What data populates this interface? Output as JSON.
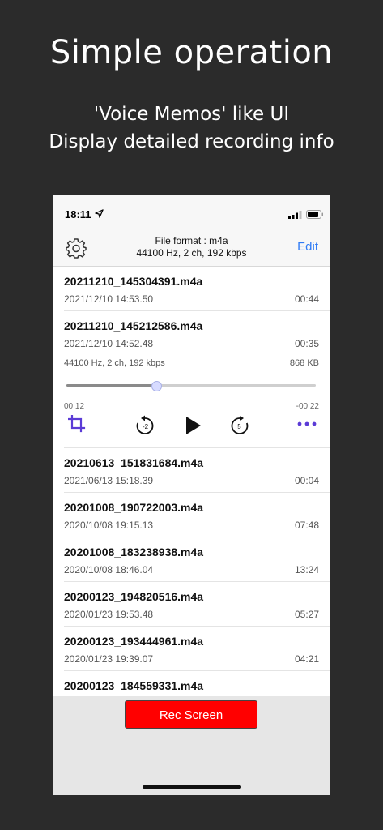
{
  "promo": {
    "title": "Simple operation",
    "subtitle_line1": "'Voice Memos' like UI",
    "subtitle_line2": "Display detailed recording info"
  },
  "status_bar": {
    "time": "18:11"
  },
  "nav": {
    "title_line1": "File format : m4a",
    "title_line2": "44100 Hz, 2 ch, 192 kbps",
    "edit_label": "Edit"
  },
  "recordings": [
    {
      "name": "20211210_145304391.m4a",
      "date": "2021/12/10 14:53.50",
      "duration": "00:44"
    }
  ],
  "expanded": {
    "name": "20211210_145212586.m4a",
    "date": "2021/12/10 14:52.48",
    "duration": "00:35",
    "info": "44100 Hz, 2 ch, 192 kbps",
    "size": "868 KB",
    "elapsed": "00:12",
    "remaining": "-00:22",
    "progress": 0.36,
    "skip_back_seconds": "-2",
    "skip_forward_seconds": "5"
  },
  "recordings_after": [
    {
      "name": "20210613_151831684.m4a",
      "date": "2021/06/13 15:18.39",
      "duration": "00:04"
    },
    {
      "name": "20201008_190722003.m4a",
      "date": "2020/10/08 19:15.13",
      "duration": "07:48"
    },
    {
      "name": "20201008_183238938.m4a",
      "date": "2020/10/08 18:46.04",
      "duration": "13:24"
    },
    {
      "name": "20200123_194820516.m4a",
      "date": "2020/01/23 19:53.48",
      "duration": "05:27"
    },
    {
      "name": "20200123_193444961.m4a",
      "date": "2020/01/23 19:39.07",
      "duration": "04:21"
    },
    {
      "name": "20200123_184559331.m4a",
      "date": "",
      "duration": ""
    }
  ],
  "bottom": {
    "rec_label": "Rec Screen"
  },
  "colors": {
    "accent": "#2f7bf5",
    "control_purple": "#5b3bd6",
    "record_red": "#ff0000"
  },
  "icons": [
    "location-arrow-icon",
    "signal-icon",
    "battery-icon",
    "gear-icon",
    "crop-icon",
    "skip-back-icon",
    "play-icon",
    "skip-forward-icon",
    "more-icon"
  ]
}
